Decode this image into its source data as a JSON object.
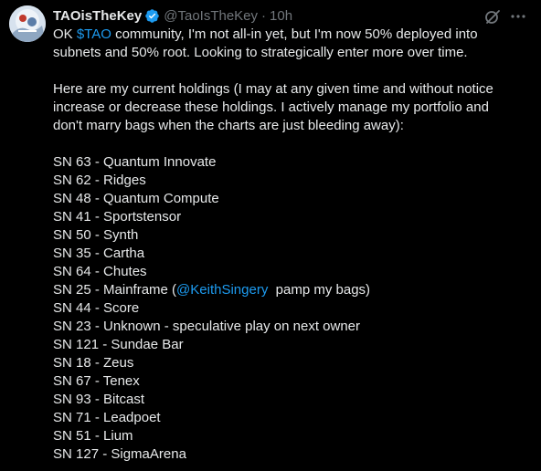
{
  "author": {
    "display_name": "TAOisTheKey",
    "handle": "@TaoIsTheKey",
    "separator": "·",
    "time": "10h",
    "verified": true
  },
  "icons": {
    "grok": "grok-icon",
    "more": "more-horizontal-icon",
    "verified": "verified-badge-icon"
  },
  "colors": {
    "background": "#000000",
    "text": "#e7e9ea",
    "muted": "#71767b",
    "link": "#1d9bf0"
  },
  "post": {
    "intro": {
      "l1_prefix": "OK ",
      "cashtag": "$TAO",
      "l1_suffix": " community, I'm not all-in yet, but I'm now 50% deployed into",
      "l2": "subnets and 50% root.  Looking to strategically enter more over time."
    },
    "holdings_intro": {
      "l1": "Here are my current holdings (I may at any given time and without notice",
      "l2": "increase or decrease these holdings.  I actively manage my portfolio and",
      "l3": "don't marry bags when the charts are just bleeding away):"
    },
    "holdings": [
      "SN 63 - Quantum Innovate",
      "SN 62 - Ridges",
      "SN 48 - Quantum Compute",
      "SN 41 - Sportstensor",
      "SN 50 - Synth",
      "SN 35 - Cartha",
      "SN 64 - Chutes"
    ],
    "mainframe": {
      "prefix": "SN 25 - Mainframe (",
      "mention": "@KeithSingery",
      "suffix": "  pamp my bags)"
    },
    "holdings_after": [
      "SN 44 - Score",
      "SN 23 - Unknown - speculative play on next owner",
      "SN 121 - Sundae Bar",
      "SN 18 - Zeus",
      "SN 67 - Tenex",
      "SN 93 - Bitcast",
      "SN 71 - Leadpoet",
      "SN 51 - Lium",
      "SN 127 - SigmaArena"
    ]
  }
}
